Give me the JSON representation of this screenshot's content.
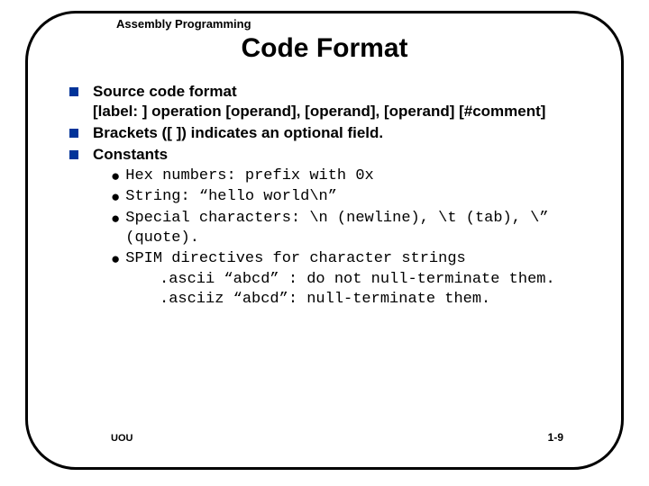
{
  "chapter": "Assembly Programming",
  "title": "Code Format",
  "bullets": {
    "b1_line1": "Source code format",
    "b1_line2": "[label: ] operation [operand], [operand], [operand] [#comment]",
    "b2": "Brackets ([ ]) indicates an optional field.",
    "b3": "Constants"
  },
  "subs": {
    "s1": "Hex numbers: prefix with 0x",
    "s2": "String: “hello world\\n”",
    "s3": "Special characters: \\n (newline), \\t (tab), \\” (quote).",
    "s4": "SPIM directives for character strings",
    "s4a": ".ascii “abcd” : do not null-terminate them.",
    "s4b": ".asciiz “abcd”: null-terminate them."
  },
  "footer": {
    "left": "UOU",
    "right": "1-9"
  }
}
